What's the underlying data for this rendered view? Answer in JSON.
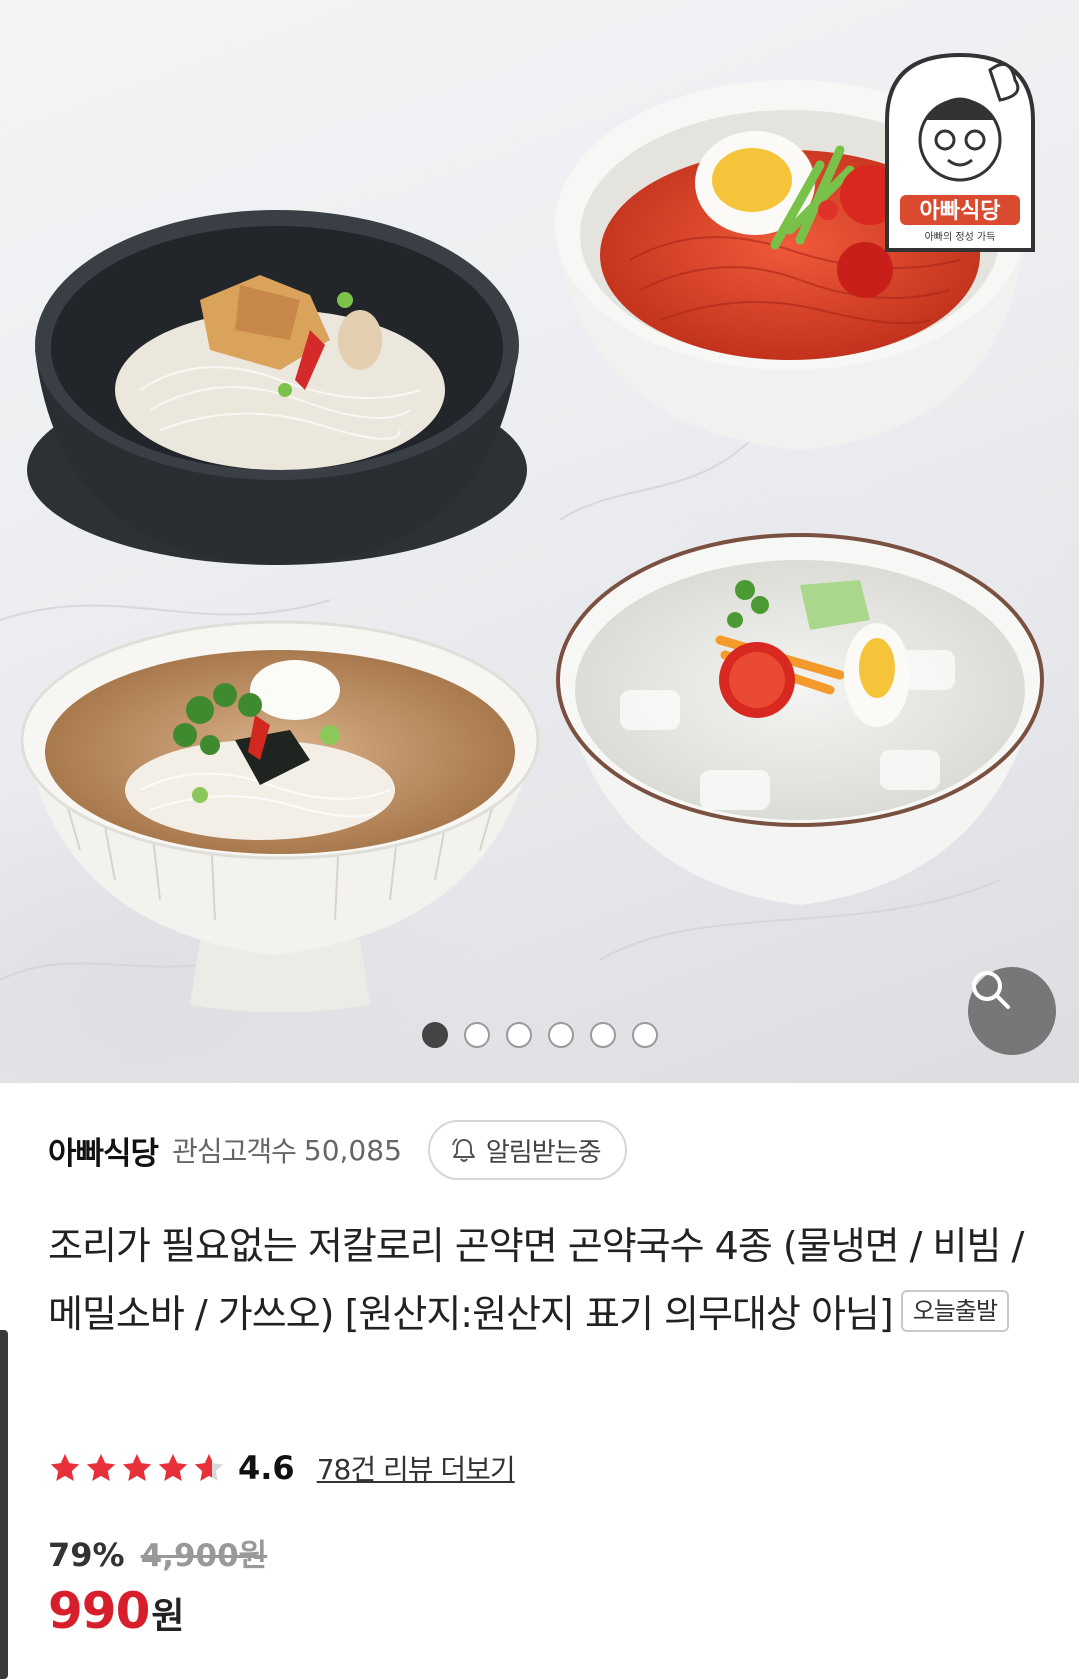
{
  "hero": {
    "logo_text": "아빠식당",
    "logo_subtext": "아빠의 정성 가득",
    "image_count": 6,
    "active_index": 0
  },
  "icons": {
    "zoom": "magnifier-icon",
    "bell": "bell-icon",
    "star": "star-icon"
  },
  "seller": {
    "name": "아빠식당",
    "follower_label": "관심고객수",
    "follower_count": "50,085",
    "notify_label": "알림받는중"
  },
  "product": {
    "title": "조리가 필요없는 저칼로리 곤약면 곤약국수 4종 (물냉면 / 비빔 / 메밀소바 / 가쓰오) [원산지:원산지 표기 의무대상 아님]",
    "badge": "오늘출발"
  },
  "rating": {
    "value": "4.6",
    "stars": 4.6,
    "review_link": "78건 리뷰 더보기"
  },
  "price": {
    "discount": "79%",
    "original": "4,900원",
    "sale": "990",
    "unit": "원"
  },
  "colors": {
    "accent_red": "#d61f2b",
    "star_red": "#e8303a"
  }
}
